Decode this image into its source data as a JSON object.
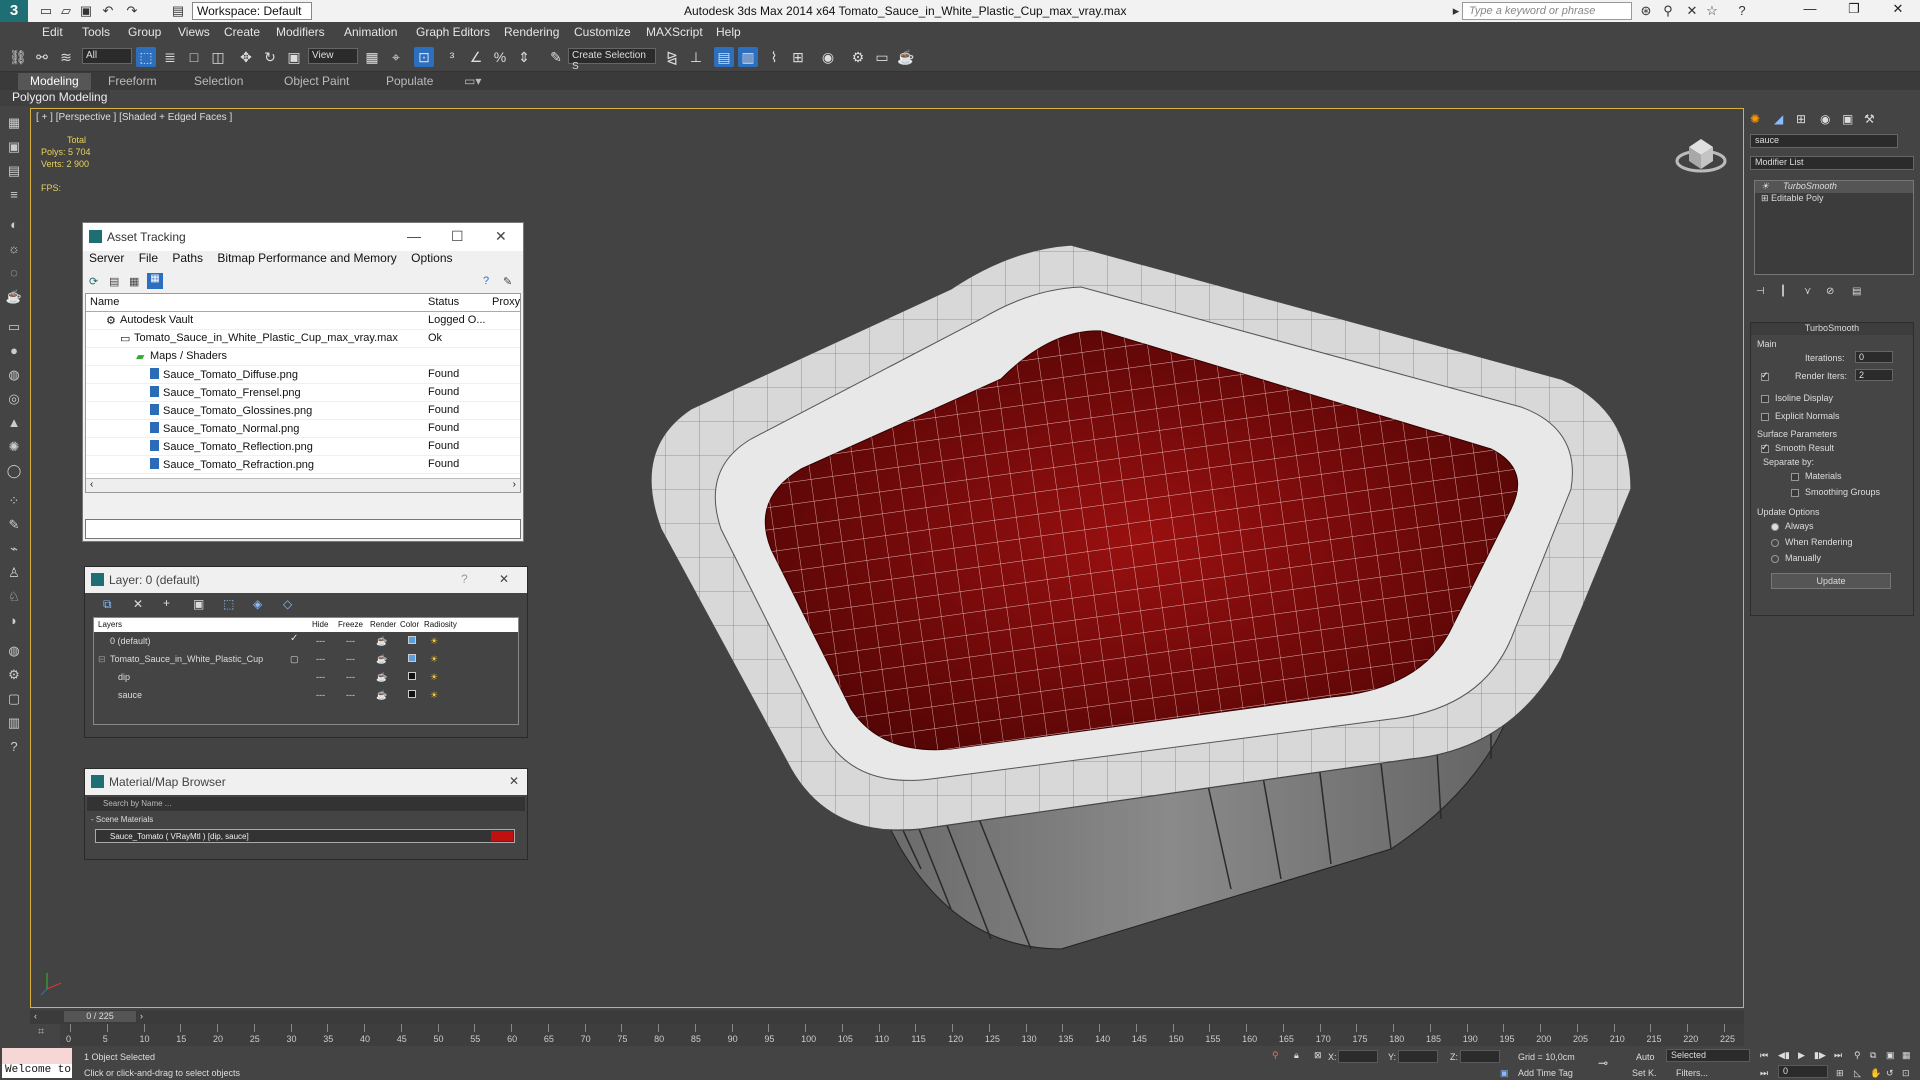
{
  "titlebar": {
    "workspace": "Workspace: Default",
    "title": "Autodesk 3ds Max  2014 x64     Tomato_Sauce_in_White_Plastic_Cup_max_vray.max",
    "search_placeholder": "Type a keyword or phrase"
  },
  "menu": [
    "Edit",
    "Tools",
    "Group",
    "Views",
    "Create",
    "Modifiers",
    "Animation",
    "Graph Editors",
    "Rendering",
    "Customize",
    "MAXScript",
    "Help"
  ],
  "toolbar": {
    "filter": "All",
    "refcoord": "View",
    "selection_set": "Create Selection S"
  },
  "ribbon": {
    "tabs": [
      "Modeling",
      "Freeform",
      "Selection",
      "Object Paint",
      "Populate"
    ],
    "sub": "Polygon Modeling"
  },
  "viewport": {
    "label": "[ + ] [Perspective ] [Shaded + Edged Faces ]",
    "stats_total": "Total",
    "polys": "Polys:  5 704",
    "verts": "Verts:  2 900",
    "fps": "FPS:"
  },
  "asset_tracking": {
    "title": "Asset Tracking",
    "menu": [
      "Server",
      "File",
      "Paths",
      "Bitmap Performance and Memory",
      "Options"
    ],
    "columns": [
      "Name",
      "Status",
      "Proxy"
    ],
    "rows": [
      {
        "name": "Autodesk Vault",
        "status": "Logged O..."
      },
      {
        "name": "Tomato_Sauce_in_White_Plastic_Cup_max_vray.max",
        "status": "Ok"
      },
      {
        "name": "Maps / Shaders",
        "status": ""
      },
      {
        "name": "Sauce_Tomato_Diffuse.png",
        "status": "Found"
      },
      {
        "name": "Sauce_Tomato_Frensel.png",
        "status": "Found"
      },
      {
        "name": "Sauce_Tomato_Glossines.png",
        "status": "Found"
      },
      {
        "name": "Sauce_Tomato_Normal.png",
        "status": "Found"
      },
      {
        "name": "Sauce_Tomato_Reflection.png",
        "status": "Found"
      },
      {
        "name": "Sauce_Tomato_Refraction.png",
        "status": "Found"
      }
    ]
  },
  "layer_panel": {
    "title": "Layer: 0 (default)",
    "columns": [
      "Layers",
      "Hide",
      "Freeze",
      "Render",
      "Color",
      "Radiosity"
    ],
    "rows": [
      {
        "name": "0 (default)",
        "color": "#5aa0e0"
      },
      {
        "name": "Tomato_Sauce_in_White_Plastic_Cup",
        "color": "#5aa0e0"
      },
      {
        "name": "dip",
        "color": "#111111"
      },
      {
        "name": "sauce",
        "color": "#111111"
      }
    ]
  },
  "material_browser": {
    "title": "Material/Map Browser",
    "search_placeholder": "Search by Name ...",
    "group": "- Scene Materials",
    "item": "Sauce_Tomato  ( VRayMtl )  [dip, sauce]"
  },
  "command_panel": {
    "search_value": "sauce",
    "modifier_list": "Modifier List",
    "stack": [
      "TurboSmooth",
      "Editable Poly"
    ],
    "rollout": "TurboSmooth",
    "main": "Main",
    "iterations_label": "Iterations:",
    "iterations": "0",
    "render_iters_label": "Render Iters:",
    "render_iters": "2",
    "isoline": "Isoline Display",
    "explicit": "Explicit Normals",
    "surface": "Surface Parameters",
    "smooth_result": "Smooth Result",
    "separate": "Separate by:",
    "materials": "Materials",
    "smoothing_groups": "Smoothing Groups",
    "update_options": "Update Options",
    "always": "Always",
    "when_rendering": "When Rendering",
    "manually": "Manually",
    "update_btn": "Update"
  },
  "timeline": {
    "frame": "0 / 225",
    "ticks": [
      "0",
      "5",
      "10",
      "15",
      "20",
      "25",
      "30",
      "35",
      "40",
      "45",
      "50",
      "55",
      "60",
      "65",
      "70",
      "75",
      "80",
      "85",
      "90",
      "95",
      "100",
      "105",
      "110",
      "115",
      "120",
      "125",
      "130",
      "135",
      "140",
      "145",
      "150",
      "155",
      "160",
      "165",
      "170",
      "175",
      "180",
      "185",
      "190",
      "195",
      "200",
      "205",
      "210",
      "215",
      "220",
      "225"
    ]
  },
  "status": {
    "welcome": "Welcome to",
    "selected": "1 Object Selected",
    "hint": "Click or click-and-drag to select objects",
    "x": "X:",
    "y": "Y:",
    "z": "Z:",
    "grid": "Grid = 10,0cm",
    "add_time_tag": "Add Time Tag",
    "auto": "Auto",
    "set_k": "Set K.",
    "selected_dd": "Selected",
    "filters": "Filters...",
    "frame_value": "0"
  }
}
